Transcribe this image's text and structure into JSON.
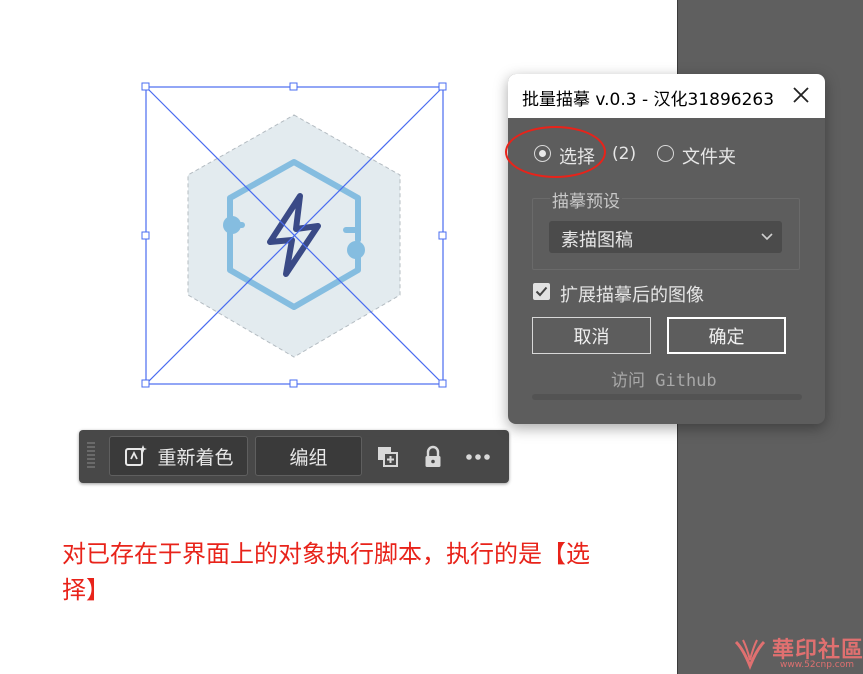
{
  "dialog": {
    "title": "批量描摹 v.0.3 - 汉化31896263",
    "source_option_selection": "选择",
    "selection_count": "(2)",
    "source_option_folder": "文件夹",
    "preset_group_label": "描摹预设",
    "preset_selected": "素描图稿",
    "expand_checkbox_label": "扩展描摹后的图像",
    "expand_checked": true,
    "cancel_label": "取消",
    "ok_label": "确定",
    "github_link": "访问 Github"
  },
  "toolbar": {
    "recolor_label": "重新着色",
    "group_label": "编组"
  },
  "annotation": {
    "caption": "对已存在于界面上的对象执行脚本，执行的是【选择】",
    "color": "#e8231a"
  },
  "watermark": {
    "text": "華印社區",
    "url": "www.52cnp.com"
  },
  "colors": {
    "canvas_bg": "#ffffff",
    "panel_bg": "#5f5f5f",
    "dialog_bg": "#5d5d5d",
    "toolbar_bg": "#484848",
    "selection_blue": "#4a6cf0",
    "hexagon_fill": "#e3ebef",
    "icon_light_blue": "#85bde0",
    "bolt_navy": "#3a4a86"
  }
}
